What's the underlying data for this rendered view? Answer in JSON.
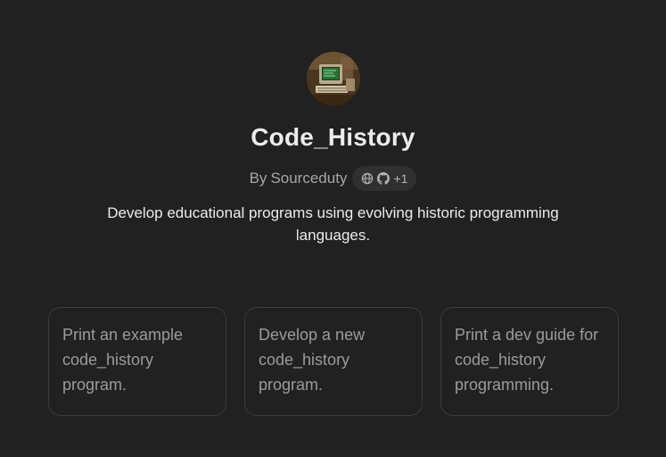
{
  "gpt": {
    "name": "Code_History",
    "author_prefix": "By",
    "author": "Sourceduty",
    "extra_links": "+1",
    "description": "Develop educational programs using evolving historic programming languages."
  },
  "icons": {
    "avatar": "retro-computer-avatar",
    "website": "globe-icon",
    "github": "github-icon"
  },
  "conversation_starters": [
    {
      "label": "Print an example code_history program."
    },
    {
      "label": "Develop a new code_history program."
    },
    {
      "label": "Print a dev guide for code_history programming."
    }
  ],
  "colors": {
    "background": "#212121",
    "card_border": "#3d3d3d",
    "pill_background": "#303030"
  }
}
